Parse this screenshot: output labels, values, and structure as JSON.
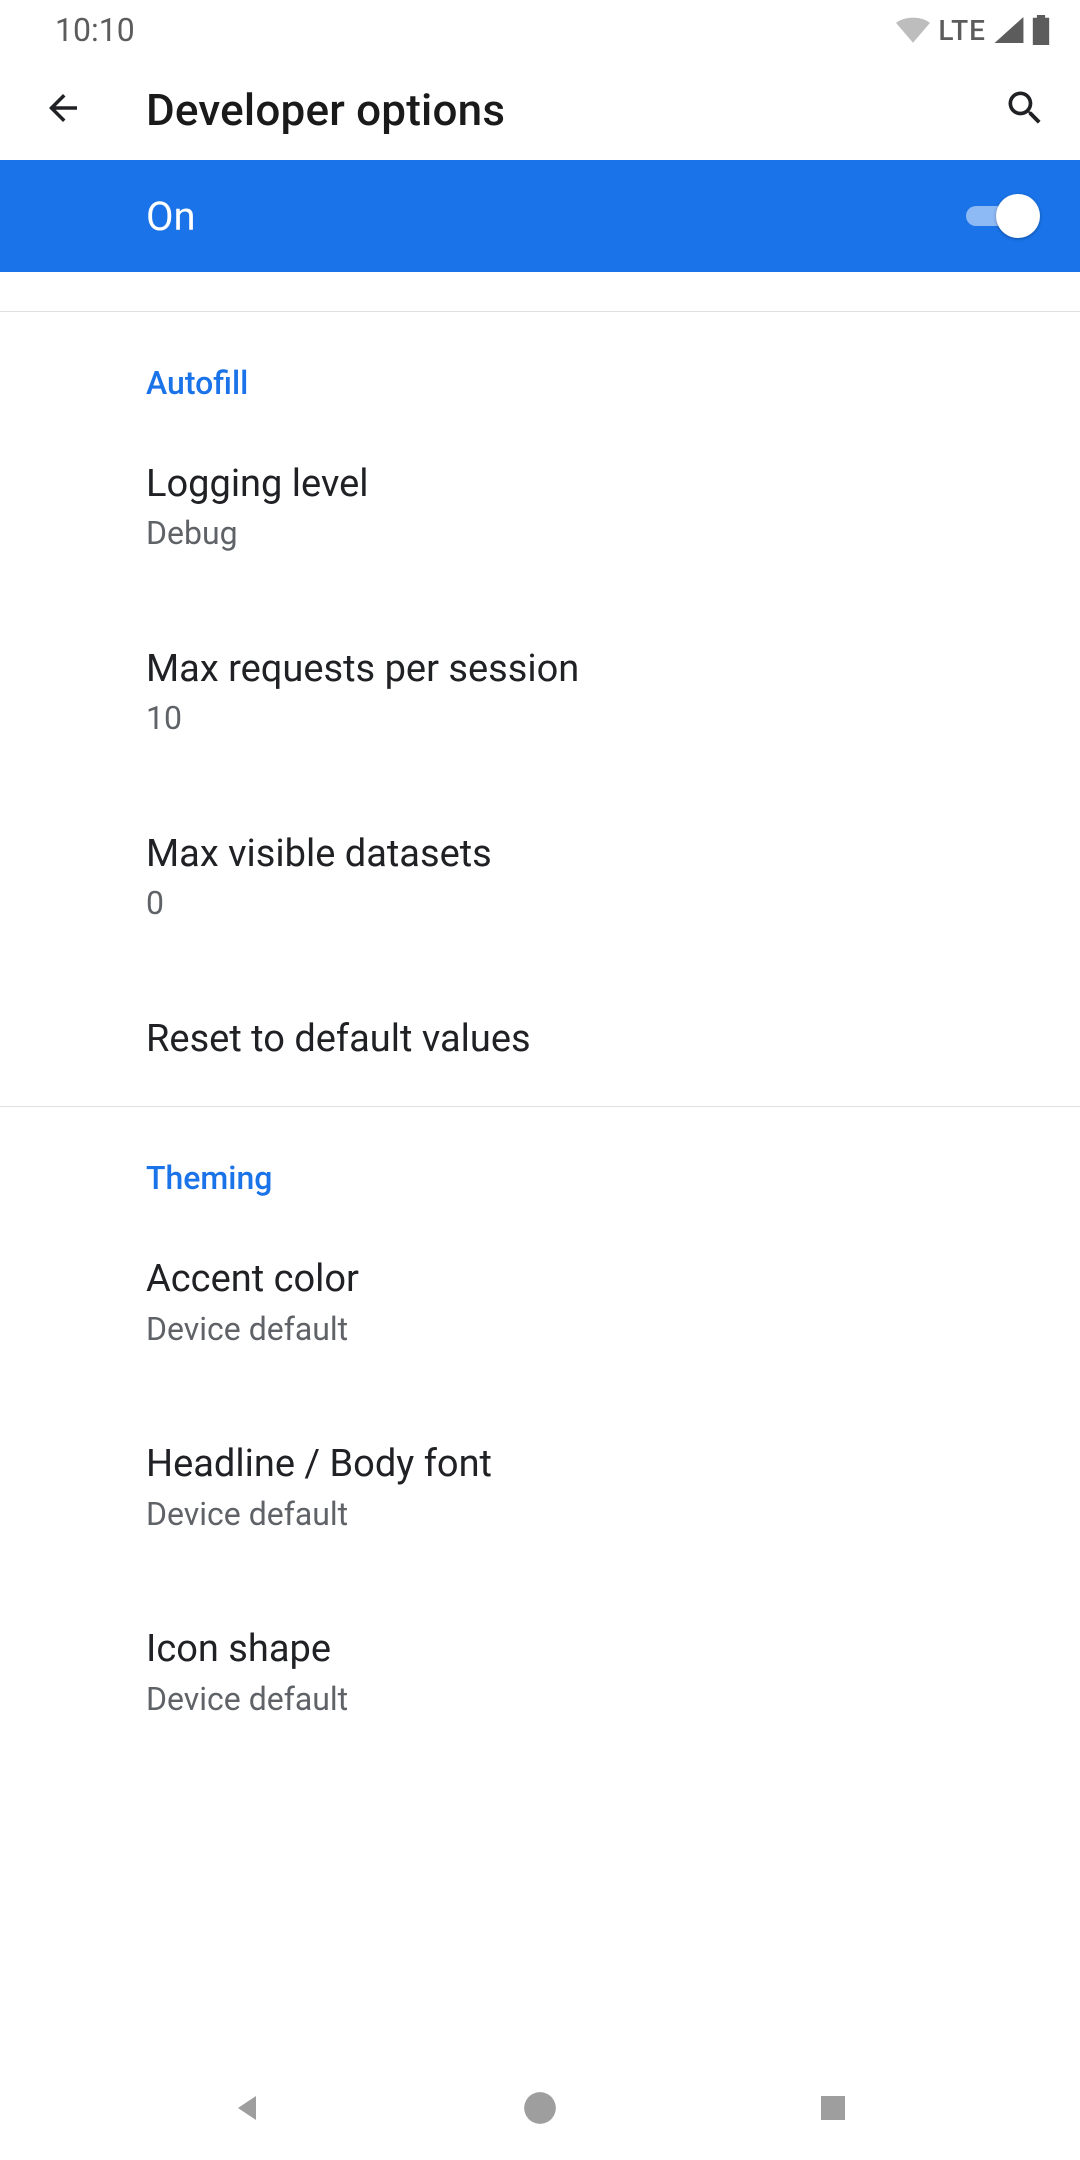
{
  "status": {
    "time": "10:10",
    "network": "LTE"
  },
  "header": {
    "title": "Developer options"
  },
  "master_toggle": {
    "label": "On",
    "checked": true
  },
  "sections": [
    {
      "title": "Autofill",
      "items": [
        {
          "title": "Logging level",
          "summary": "Debug"
        },
        {
          "title": "Max requests per session",
          "summary": "10"
        },
        {
          "title": "Max visible datasets",
          "summary": "0"
        },
        {
          "title": "Reset to default values"
        }
      ]
    },
    {
      "title": "Theming",
      "items": [
        {
          "title": "Accent color",
          "summary": "Device default"
        },
        {
          "title": "Headline / Body font",
          "summary": "Device default"
        },
        {
          "title": "Icon shape",
          "summary": "Device default"
        }
      ]
    }
  ]
}
